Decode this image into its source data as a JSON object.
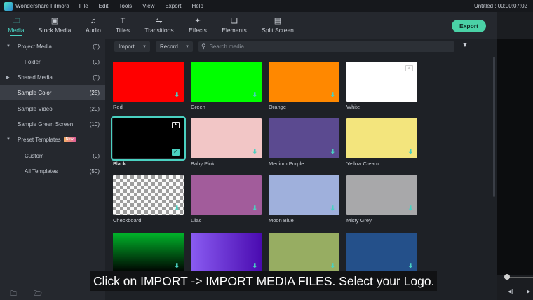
{
  "titlebar": {
    "app_name": "Wondershare Filmora",
    "menu": [
      "File",
      "Edit",
      "Tools",
      "View",
      "Export",
      "Help"
    ],
    "project_title": "Untitled : 00:00:07:02"
  },
  "tabs": [
    {
      "label": "Media",
      "icon": "folder-icon",
      "active": true
    },
    {
      "label": "Stock Media",
      "icon": "stock-media-icon",
      "active": false
    },
    {
      "label": "Audio",
      "icon": "music-note-icon",
      "active": false
    },
    {
      "label": "Titles",
      "icon": "text-t-icon",
      "active": false
    },
    {
      "label": "Transitions",
      "icon": "transition-icon",
      "active": false
    },
    {
      "label": "Effects",
      "icon": "sparkle-icon",
      "active": false
    },
    {
      "label": "Elements",
      "icon": "elements-icon",
      "active": false
    },
    {
      "label": "Split Screen",
      "icon": "split-screen-icon",
      "active": false
    }
  ],
  "export_label": "Export",
  "sidebar": {
    "items": [
      {
        "label": "Project Media",
        "count": "(0)",
        "expanded": true
      },
      {
        "label": "Folder",
        "count": "(0)"
      },
      {
        "label": "Shared Media",
        "count": "(0)",
        "expanded": false
      },
      {
        "label": "Sample Color",
        "count": "(25)",
        "selected": true
      },
      {
        "label": "Sample Video",
        "count": "(20)"
      },
      {
        "label": "Sample Green Screen",
        "count": "(10)"
      },
      {
        "label": "Preset Templates",
        "count": "",
        "badge": "New",
        "expanded": true
      },
      {
        "label": "Custom",
        "count": "(0)"
      },
      {
        "label": "All Templates",
        "count": "(50)"
      }
    ]
  },
  "filterbar": {
    "import_label": "Import",
    "record_label": "Record",
    "search_placeholder": "Search media"
  },
  "media": [
    {
      "name": "Red",
      "color": "#ff0000"
    },
    {
      "name": "Green",
      "color": "#00ff00"
    },
    {
      "name": "Orange",
      "color": "#ff8800"
    },
    {
      "name": "White",
      "color": "#ffffff"
    },
    {
      "name": "Black",
      "color": "#000000",
      "selected": true
    },
    {
      "name": "Baby Pink",
      "color": "#f2c6c6"
    },
    {
      "name": "Medium Purple",
      "color": "#5b4a90"
    },
    {
      "name": "Yellow Cream",
      "color": "#f3e57d"
    },
    {
      "name": "Checkboard",
      "color": "checker"
    },
    {
      "name": "Lilac",
      "color": "#a25c9b"
    },
    {
      "name": "Moon Blue",
      "color": "#9fb0dc"
    },
    {
      "name": "Misty Grey",
      "color": "#a8a8aa"
    },
    {
      "name": "",
      "color": "linear-gradient(180deg,#00b52a,#000000)"
    },
    {
      "name": "",
      "color": "linear-gradient(90deg,#8a5cf2,#4a0bb0)"
    },
    {
      "name": "",
      "color": "#97ad62"
    },
    {
      "name": "",
      "color": "#24508a"
    }
  ],
  "caption": "Click on IMPORT -> IMPORT MEDIA FILES. Select your Logo."
}
